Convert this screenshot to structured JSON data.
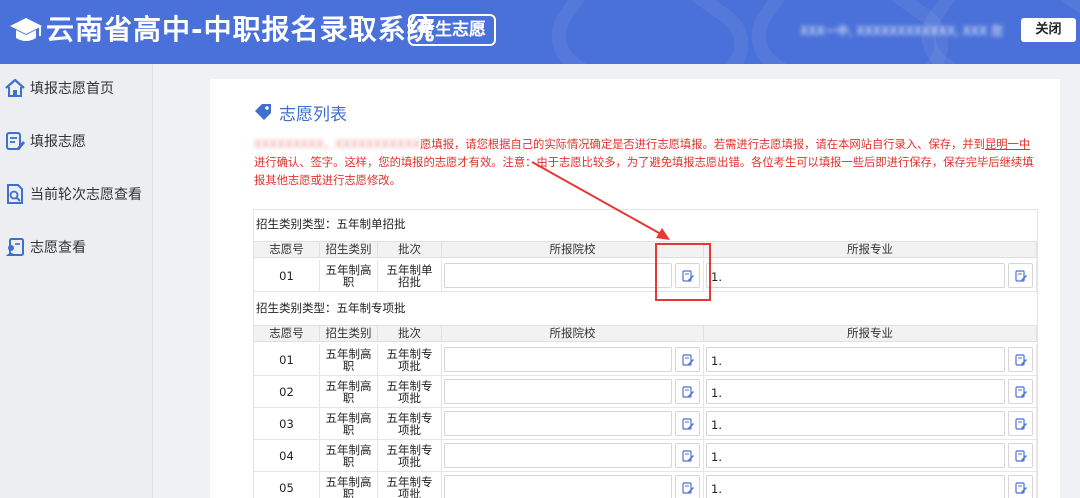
{
  "header": {
    "title": "云南省高中-中职报名录取系统",
    "badge": "考生志愿",
    "user_info": "XXX一中, XXXXXXXXXXXX, XXX 您",
    "close_label": "关闭"
  },
  "sidebar": {
    "items": [
      {
        "label": "填报志愿首页",
        "icon": "home-icon"
      },
      {
        "label": "填报志愿",
        "icon": "form-edit-icon"
      },
      {
        "label": "当前轮次志愿查看",
        "icon": "document-search-icon"
      },
      {
        "label": "志愿查看",
        "icon": "user-document-icon"
      }
    ]
  },
  "main": {
    "title": "志愿列表",
    "notice": {
      "blurred_prefix": "XXXXXXXXX，XXXXXXXXXXX",
      "text_part1": "愿填报，请您根据自己的实际情况确定是否进行志愿填报。若需进行志愿填报，请在本网站自行录入、保存，并到",
      "underlined": "昆明一中",
      "text_part2": "进行确认、签字。这样，您的填报的志愿才有效。注意：由于志愿比较多，为了避免填报志愿出错。各位考生可以填报一些后即进行保存，保存完毕后继续填报其他志愿或进行志愿修改。"
    },
    "columns": [
      "志愿号",
      "招生类别",
      "批次",
      "所报院校",
      "所报专业"
    ],
    "groups": [
      {
        "label": "招生类别类型：五年制单招批",
        "rows": [
          {
            "no": "01",
            "category": "五年制高职",
            "batch": "五年制单招批",
            "school": "",
            "major": "1."
          }
        ]
      },
      {
        "label": "招生类别类型：五年制专项批",
        "rows": [
          {
            "no": "01",
            "category": "五年制高职",
            "batch": "五年制专项批",
            "school": "",
            "major": "1."
          },
          {
            "no": "02",
            "category": "五年制高职",
            "batch": "五年制专项批",
            "school": "",
            "major": "1."
          },
          {
            "no": "03",
            "category": "五年制高职",
            "batch": "五年制专项批",
            "school": "",
            "major": "1."
          },
          {
            "no": "04",
            "category": "五年制高职",
            "batch": "五年制专项批",
            "school": "",
            "major": "1."
          },
          {
            "no": "05",
            "category": "五年制高职",
            "batch": "五年制专项批",
            "school": "",
            "major": "1."
          }
        ]
      }
    ]
  },
  "colors": {
    "header_bg": "#4a71d9",
    "accent_blue": "#3f6fcf",
    "notice_red": "#e0322c",
    "annotation_red": "#e53935"
  }
}
